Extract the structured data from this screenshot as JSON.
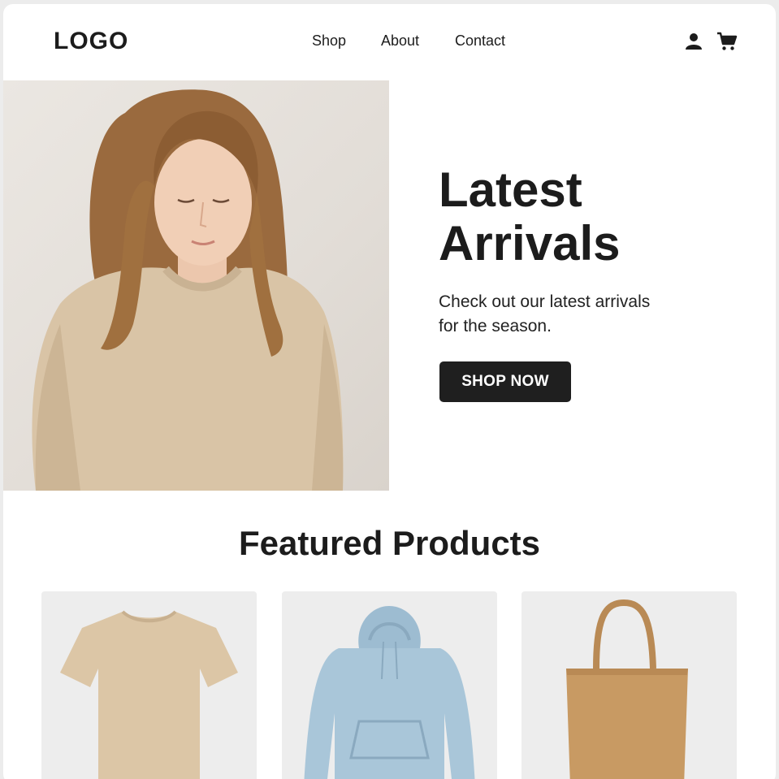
{
  "header": {
    "logo": "LOGO",
    "nav": [
      "Shop",
      "About",
      "Contact"
    ],
    "icons": [
      "user-icon",
      "cart-icon"
    ]
  },
  "hero": {
    "title_line1": "Latest",
    "title_line2": "Arrivals",
    "subtitle_line1": "Check out our latest arrivals",
    "subtitle_line2": "for the season.",
    "cta": "SHOP NOW"
  },
  "featured": {
    "title": "Featured Products",
    "products": [
      "beige t-shirt",
      "light blue hoodie",
      "tan tote bag"
    ]
  },
  "colors": {
    "accent": "#1f1f1f",
    "card_bg": "#ededed",
    "sweater": "#d9c4a6",
    "hoodie": "#a9c6d9",
    "tote": "#c89a63"
  }
}
